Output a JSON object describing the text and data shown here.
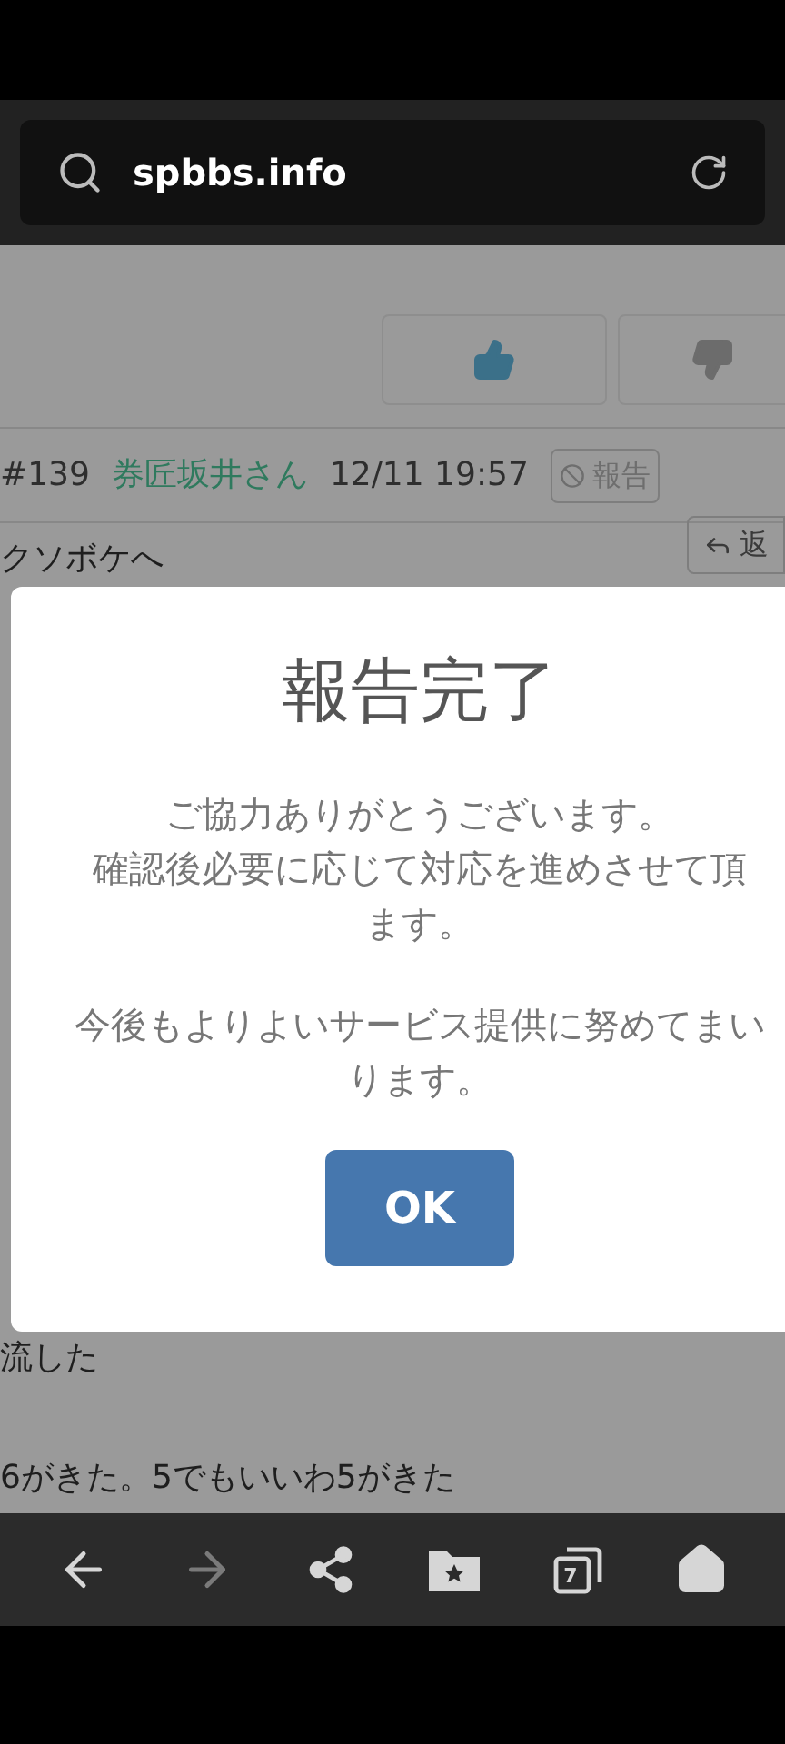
{
  "address_bar": {
    "url": "spbbs.info"
  },
  "post": {
    "number": "#139",
    "author": "券匠坂井さん",
    "time": "12/11 19:57",
    "report_label": "報告",
    "reply_label": "返",
    "lines": [
      "クソボケへ",
      "流した",
      "6がきた。5でもいいわ5がきた"
    ]
  },
  "dialog": {
    "title": "報告完了",
    "paragraphs": [
      {
        "lines": [
          "ご協力ありがとうございます。",
          "確認後必要に応じて対応を進めさせて頂",
          "ます。"
        ]
      },
      {
        "lines": [
          "今後もよりよいサービス提供に努めてまい",
          "ります。"
        ]
      }
    ],
    "button": "OK"
  },
  "nav": [
    {
      "kind": "back",
      "disabled": false
    },
    {
      "kind": "forward",
      "disabled": true
    },
    {
      "kind": "share",
      "disabled": false
    },
    {
      "kind": "bookmarks",
      "disabled": false
    },
    {
      "kind": "tabs",
      "disabled": false,
      "count": "7"
    },
    {
      "kind": "home",
      "disabled": false
    }
  ]
}
